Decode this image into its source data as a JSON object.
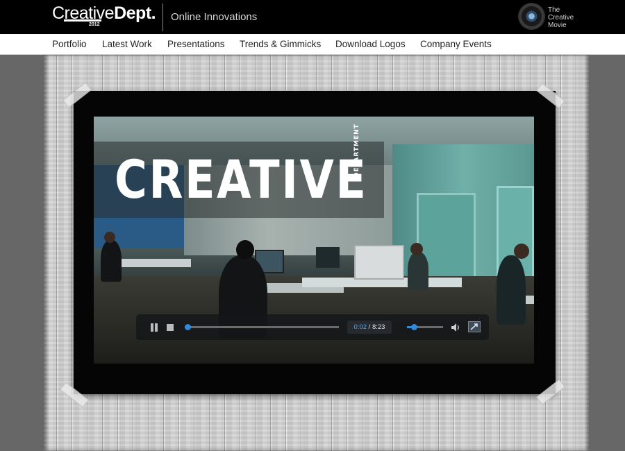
{
  "header": {
    "logo": {
      "part1": "Creative",
      "part2": "Dept.",
      "year": "2012"
    },
    "tagline": "Online Innovations",
    "movie_badge": {
      "icon": "film-reel-icon",
      "line1": "The",
      "line2": "Creative",
      "line3": "Movie"
    }
  },
  "nav": {
    "items": [
      {
        "label": "Portfolio"
      },
      {
        "label": "Latest Work"
      },
      {
        "label": "Presentations"
      },
      {
        "label": "Trends & Gimmicks"
      },
      {
        "label": "Download Logos"
      },
      {
        "label": "Company Events"
      }
    ]
  },
  "video": {
    "title": "CREATIVE",
    "subtitle": "DEPARTMENT",
    "player": {
      "current_time": "0:02",
      "separator": "/",
      "total_time": "8:23",
      "progress_fraction": 0.004,
      "volume_fraction": 0.2
    }
  },
  "colors": {
    "topbar": "#000000",
    "navbar": "#ffffff",
    "accent_blue": "#2f8ad8",
    "page_background": "#666666"
  }
}
